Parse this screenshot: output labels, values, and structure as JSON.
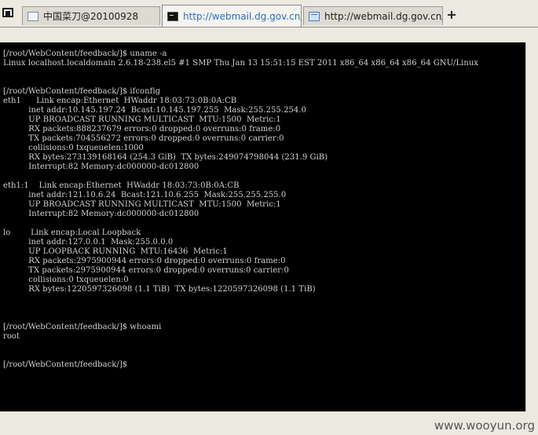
{
  "tabs": [
    {
      "label": "中国菜刀@20100928",
      "icon": "page-icon",
      "active": false
    },
    {
      "label": "http://webmail.dg.gov.cn/fee...",
      "icon": "terminal-icon",
      "active": true
    },
    {
      "label": "http://webmail.dg.gov.cn/fee...",
      "icon": "web-icon",
      "active": false
    }
  ],
  "new_tab_label": "+",
  "terminal": {
    "lines": [
      "[/root/WebContent/feedback/]$ uname -a",
      "Linux localhost.localdomain 2.6.18-238.el5 #1 SMP Thu Jan 13 15:51:15 EST 2011 x86_64 x86_64 x86_64 GNU/Linux",
      "",
      "",
      "[/root/WebContent/feedback/]$ ifconfig",
      "eth1      Link encap:Ethernet  HWaddr 18:03:73:0B:0A:CB",
      "          inet addr:10.145.197.24  Bcast:10.145.197.255  Mask:255.255.254.0",
      "          UP BROADCAST RUNNING MULTICAST  MTU:1500  Metric:1",
      "          RX packets:888237679 errors:0 dropped:0 overruns:0 frame:0",
      "          TX packets:704556272 errors:0 dropped:0 overruns:0 carrier:0",
      "          collisions:0 txqueuelen:1000",
      "          RX bytes:273139168164 (254.3 GiB)  TX bytes:249074798044 (231.9 GiB)",
      "          Interrupt:82 Memory:dc000000-dc012800",
      "",
      "eth1:1    Link encap:Ethernet  HWaddr 18:03:73:0B:0A:CB",
      "          inet addr:121.10.6.24  Bcast:121.10.6.255  Mask:255.255.255.0",
      "          UP BROADCAST RUNNING MULTICAST  MTU:1500  Metric:1",
      "          Interrupt:82 Memory:dc000000-dc012800",
      "",
      "lo        Link encap:Local Loopback",
      "          inet addr:127.0.0.1  Mask:255.0.0.0",
      "          UP LOOPBACK RUNNING  MTU:16436  Metric:1",
      "          RX packets:2975900944 errors:0 dropped:0 overruns:0 frame:0",
      "          TX packets:2975900944 errors:0 dropped:0 overruns:0 carrier:0",
      "          collisions:0 txqueuelen:0",
      "          RX bytes:1220597326098 (1.1 TiB)  TX bytes:1220597326098 (1.1 TiB)",
      "",
      "",
      "",
      "[/root/WebContent/feedback/]$ whoami",
      "root",
      "",
      "",
      "[/root/WebContent/feedback/]$"
    ]
  },
  "watermark": "www.wooyun.org",
  "colors": {
    "terminal_bg": "#000000",
    "terminal_fg": "#d2d2d2",
    "active_tab_text": "#2a6fbf",
    "chrome_bg": "#ece9e1"
  }
}
